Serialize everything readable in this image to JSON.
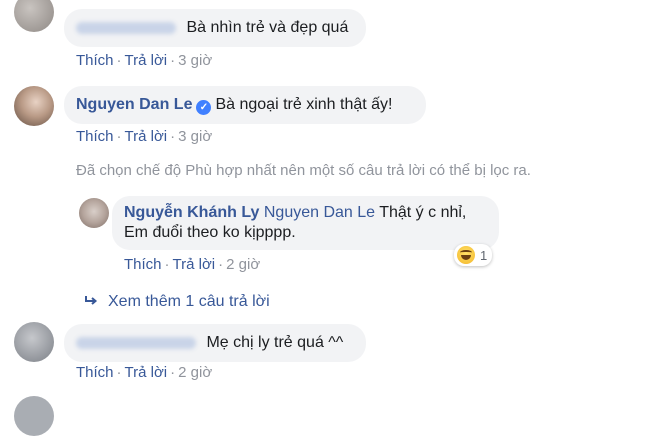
{
  "actions": {
    "like": "Thích",
    "reply": "Trả lời",
    "separator": "·"
  },
  "comments": [
    {
      "name_hidden": true,
      "text": "Bà nhìn trẻ và đẹp quá",
      "time": "3 giờ"
    },
    {
      "name": "Nguyen Dan Le",
      "verified": true,
      "text": "Bà ngoại trẻ xinh thật ấy!",
      "time": "3 giờ"
    },
    {
      "name_hidden": true,
      "text": "Mẹ chị ly trẻ quá ^^",
      "time": "2 giờ"
    }
  ],
  "filter_note": "Đã chọn chế độ Phù hợp nhất nên một số câu trả lời có thể bị lọc ra.",
  "reply": {
    "name": "Nguyễn Khánh Ly",
    "mention": "Nguyen Dan Le",
    "text_line1": "Thật ý c nhỉ,",
    "text_line2": "Em đuổi theo ko kịpppp.",
    "time": "2 giờ",
    "reaction_icon": "haha-icon",
    "reaction_count": "1"
  },
  "more_replies": "Xem thêm 1 câu trả lời",
  "more_icon": "reply-arrow-icon",
  "colors": {
    "link": "#385898",
    "muted": "#90949c",
    "bubble": "#f2f3f5"
  }
}
